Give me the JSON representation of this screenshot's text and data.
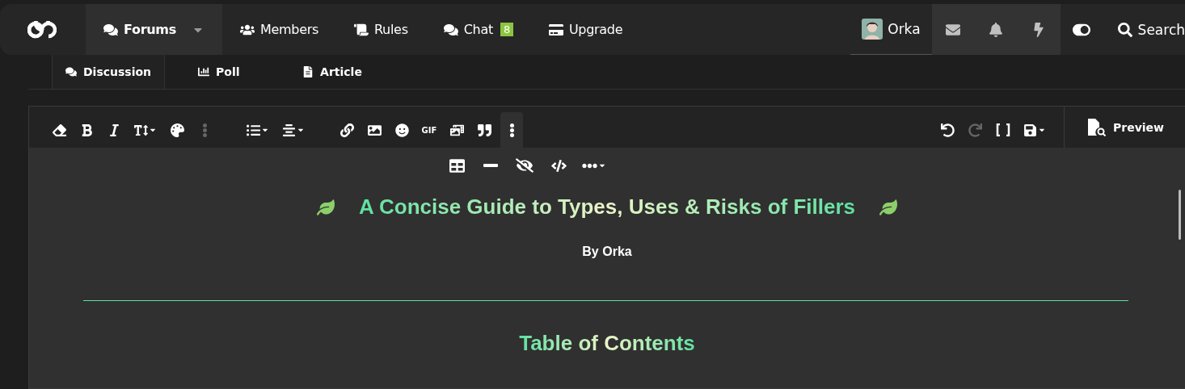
{
  "nav": {
    "items": [
      {
        "label": "Forums",
        "selected": true,
        "dropdown": true
      },
      {
        "label": "Members",
        "selected": false
      },
      {
        "label": "Rules",
        "selected": false
      },
      {
        "label": "Chat",
        "selected": false,
        "badge": "8"
      },
      {
        "label": "Upgrade",
        "selected": false
      }
    ],
    "user": {
      "name": "Orka"
    },
    "search": "Search"
  },
  "post_types": [
    {
      "label": "Discussion",
      "selected": true
    },
    {
      "label": "Poll",
      "selected": false
    },
    {
      "label": "Article",
      "selected": false
    }
  ],
  "toolbar": {
    "left": [
      {
        "kind": "icon",
        "active": false,
        "disabled": false
      },
      {
        "kind": "icon",
        "active": false,
        "disabled": false
      },
      {
        "kind": "icon",
        "active": false,
        "disabled": false
      },
      {
        "kind": "icon",
        "active": false,
        "disabled": false
      },
      {
        "kind": "icon",
        "active": false,
        "disabled": false
      },
      {
        "kind": "icon",
        "active": false,
        "disabled": true
      },
      {
        "kind": "icon",
        "active": false,
        "disabled": false
      },
      {
        "kind": "icon",
        "active": false,
        "disabled": false
      },
      {
        "kind": "icon",
        "active": false,
        "disabled": false
      },
      {
        "kind": "icon",
        "active": false,
        "disabled": false
      },
      {
        "kind": "icon",
        "active": false,
        "disabled": false
      },
      {
        "kind": "text",
        "label": "GIF",
        "active": false,
        "disabled": false
      },
      {
        "kind": "icon",
        "active": false,
        "disabled": false
      },
      {
        "kind": "icon",
        "active": false,
        "disabled": false
      },
      {
        "kind": "icon",
        "active": true,
        "disabled": false
      }
    ],
    "right": [
      {
        "disabled": false
      },
      {
        "disabled": true
      },
      {
        "disabled": false
      },
      {
        "disabled": false
      }
    ],
    "preview": "Preview"
  },
  "content": {
    "title": "A Concise Guide to Types, Uses & Risks of Fillers",
    "byline": "By Orka",
    "heading": "Table of Contents"
  }
}
